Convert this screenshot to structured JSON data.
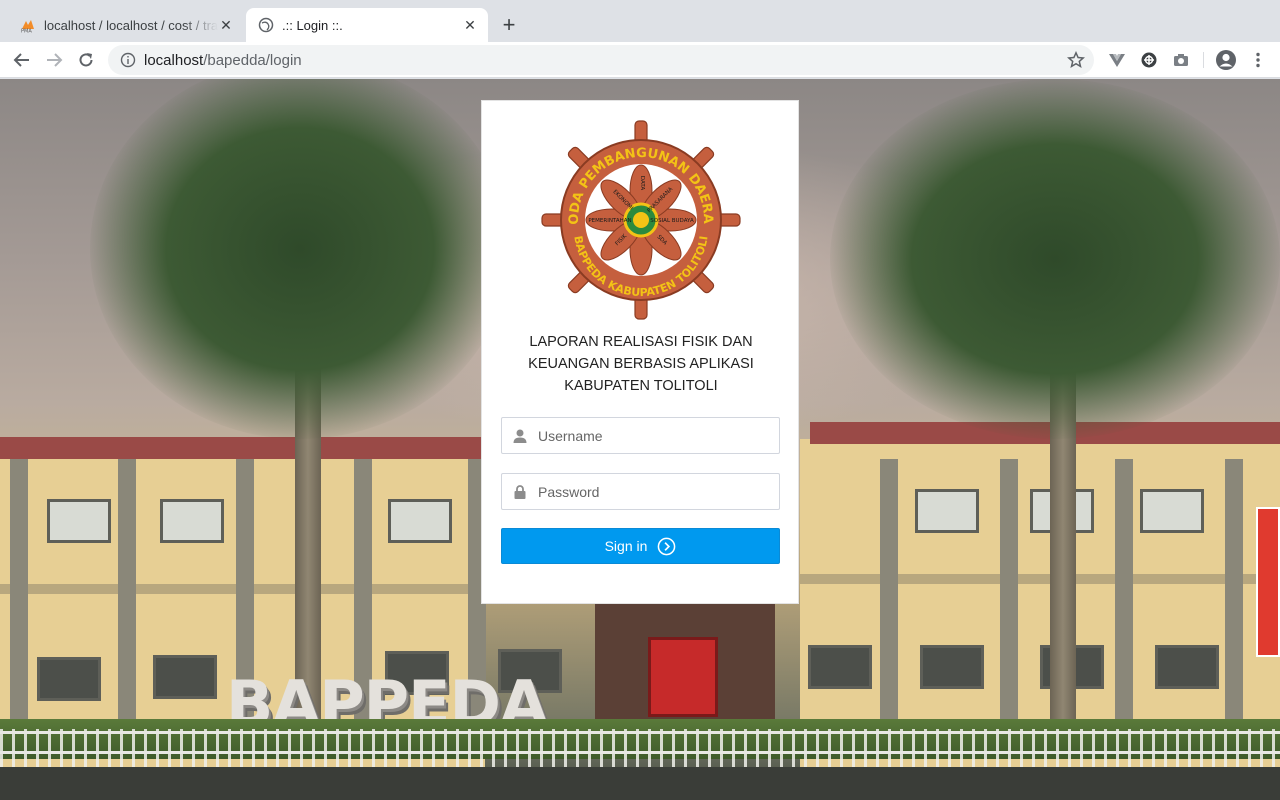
{
  "browser": {
    "tabs": [
      {
        "title": "localhost / localhost / cost / tra",
        "favicon": "phpmyadmin-icon",
        "active": false
      },
      {
        "title": ".:: Login ::.",
        "favicon": "globe-icon",
        "active": true
      }
    ],
    "address": {
      "host": "localhost",
      "path": "/bapedda/login"
    }
  },
  "logo": {
    "outer_top": "RODA PEMBANGUNAN DAERAH",
    "outer_bottom": "BAPPEDA KABUPATEN TOLITOLI",
    "spokes": [
      "DATA",
      "EKONOMI",
      "PRASARANA",
      "PEMERINTAHAN",
      "SOSIAL BUDAYA",
      "FISIK",
      "SDA"
    ],
    "colors": {
      "wheel": "#c55f3e",
      "text": "#f3c316",
      "center": "#2b8a3e"
    }
  },
  "login": {
    "title_line1": "LAPORAN REALISASI FISIK DAN",
    "title_line2": "KEUANGAN BERBASIS APLIKASI",
    "title_line3": "KABUPATEN TOLITOLI",
    "username_placeholder": "Username",
    "password_placeholder": "Password",
    "signin_label": "Sign in"
  },
  "background": {
    "sign_text": "BAPPEDA"
  },
  "colors": {
    "accent": "#0099ef"
  }
}
